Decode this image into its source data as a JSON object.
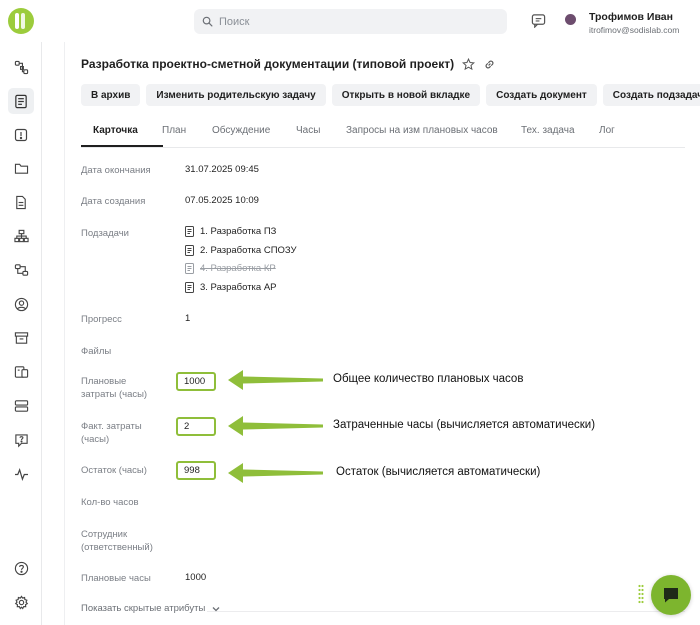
{
  "header": {
    "search_placeholder": "Поиск",
    "user_name": "Трофимов Иван",
    "user_email": "itrofimov@sodislab.com"
  },
  "sidebar": {
    "icons": [
      "tasks-flow-icon",
      "document-list-icon",
      "alert-square-icon",
      "folder-icon",
      "file-icon",
      "org-structure-icon",
      "workflow-icon",
      "user-circle-icon",
      "archive-box-icon",
      "devices-icon",
      "storage-icon",
      "help-message-icon",
      "activity-pulse-icon",
      "help-circle-icon",
      "settings-gear-icon"
    ],
    "active_index": 1
  },
  "task": {
    "title": "Разработка проектно-сметной документации (типовой проект)"
  },
  "actions": {
    "archive": "В архив",
    "change_parent": "Изменить родительскую задачу",
    "open_new_tab": "Открыть в новой вкладке",
    "create_document": "Создать документ",
    "create_subtask": "Создать подзадачу"
  },
  "tabs": [
    "Карточка",
    "План",
    "Обсуждение",
    "Часы",
    "Запросы на изм плановых часов",
    "Тех. задача",
    "Лог"
  ],
  "fields": {
    "end_date_label": "Дата окончания",
    "end_date_value": "31.07.2025 09:45",
    "created_label": "Дата создания",
    "created_value": "07.05.2025 10:09",
    "subtasks_label": "Подзадачи",
    "subtasks": [
      {
        "label": "1. Разработка ПЗ",
        "done": false
      },
      {
        "label": "2. Разработка СПОЗУ",
        "done": false
      },
      {
        "label": "4. Разработка КР",
        "done": true
      },
      {
        "label": "3. Разработка АР",
        "done": false
      }
    ],
    "progress_label": "Прогресс",
    "progress_value": "1",
    "files_label": "Файлы",
    "planned_cost_label_1": "Плановые",
    "planned_cost_label_2": "затраты (часы)",
    "planned_cost_value": "1000",
    "actual_cost_label_1": "Факт. затраты",
    "actual_cost_label_2": "(часы)",
    "actual_cost_value": "2",
    "remaining_label": "Остаток (часы)",
    "remaining_value": "998",
    "hours_count_label": "Кол-во часов",
    "employee_label_1": "Сотрудник",
    "employee_label_2": "(ответственный)",
    "planned_hours_label": "Плановые часы",
    "planned_hours_value": "1000",
    "show_hidden": "Показать скрытые атрибуты"
  },
  "annotations": {
    "planned": "Общее количество плановых часов",
    "actual": "Затраченные часы (вычисляется автоматически)",
    "remaining": "Остаток (вычисляется автоматически)"
  },
  "colors": {
    "accent_green": "#8fbe3a",
    "brand_green": "#9ccc3c",
    "chat_green": "#7db52e"
  }
}
